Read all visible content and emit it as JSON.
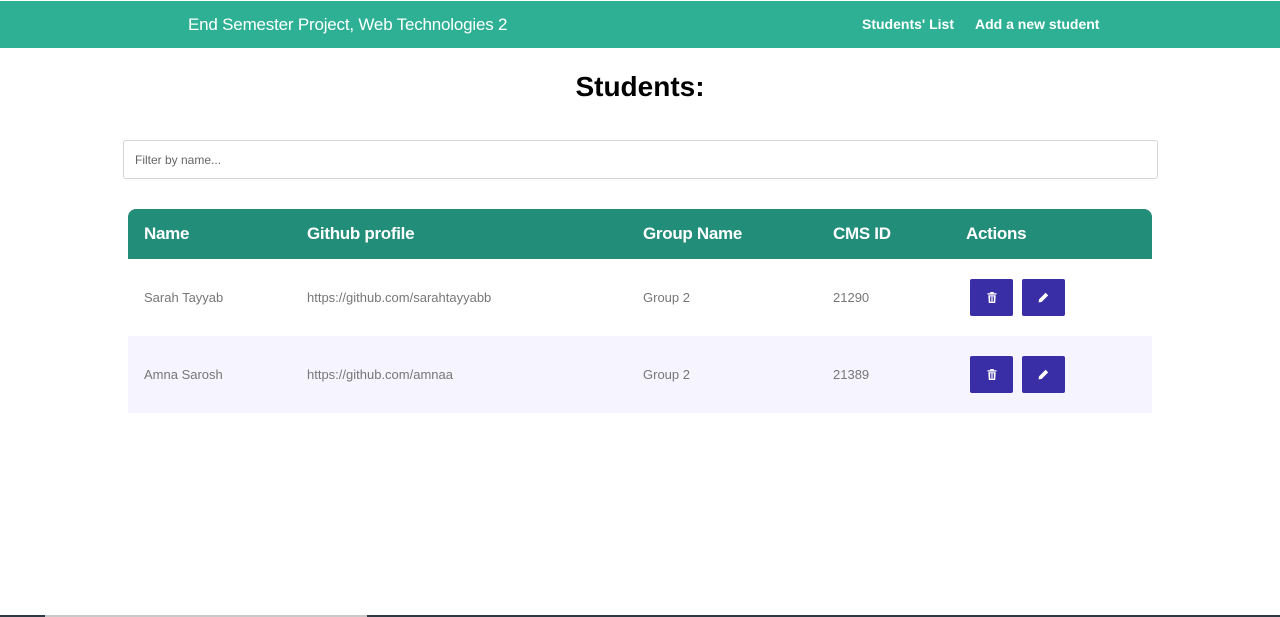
{
  "navbar": {
    "brand": "End Semester Project, Web Technologies 2",
    "links": [
      "Students' List",
      "Add a new student"
    ]
  },
  "page": {
    "title": "Students:"
  },
  "filter": {
    "placeholder": "Filter by name...",
    "value": ""
  },
  "table": {
    "headers": [
      "Name",
      "Github profile",
      "Group Name",
      "CMS ID",
      "Actions"
    ],
    "rows": [
      {
        "name": "Sarah Tayyab",
        "github": "https://github.com/sarahtayyabb",
        "group": "Group 2",
        "cms_id": "21290"
      },
      {
        "name": "Amna Sarosh",
        "github": "https://github.com/amnaa",
        "group": "Group 2",
        "cms_id": "21389"
      }
    ],
    "actions": {
      "delete_icon": "trash-icon",
      "edit_icon": "pencil-icon"
    }
  },
  "colors": {
    "navbar": "#2db094",
    "table_header": "#228d79",
    "action_button": "#3a2ea6",
    "alt_row": "#f5f4ff"
  }
}
